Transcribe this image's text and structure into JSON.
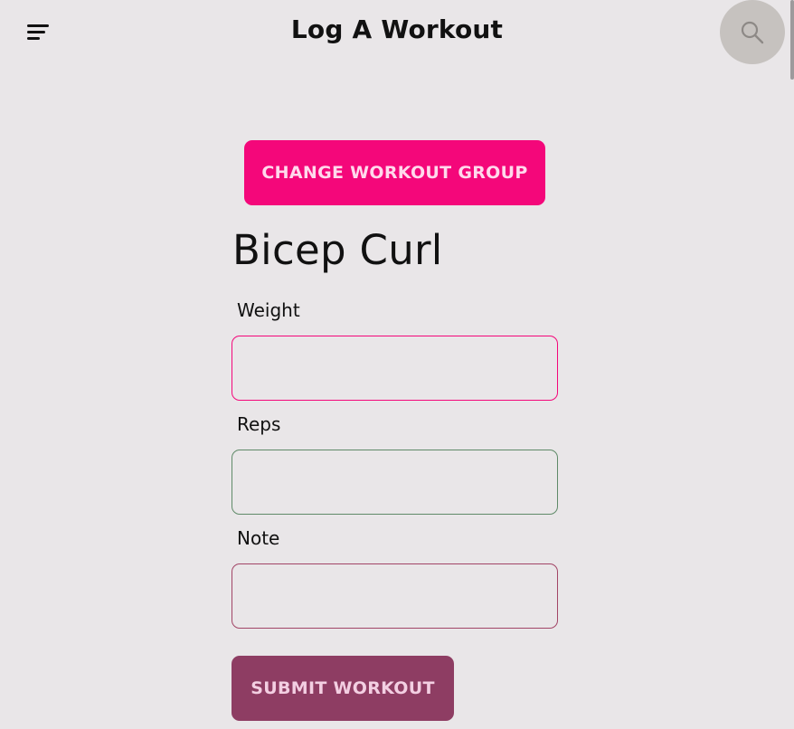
{
  "header": {
    "title": "Log A Workout",
    "menu_icon": "hamburger-menu-icon",
    "search_icon": "search-icon"
  },
  "actions": {
    "change_group_label": "CHANGE WORKOUT GROUP",
    "submit_label": "SUBMIT WORKOUT"
  },
  "exercise": {
    "name": "Bicep Curl"
  },
  "form": {
    "weight": {
      "label": "Weight",
      "value": "",
      "border_color": "#f4077a"
    },
    "reps": {
      "label": "Reps",
      "value": "",
      "border_color": "#5f8a68"
    },
    "note": {
      "label": "Note",
      "value": "",
      "border_color": "#a24566"
    }
  },
  "colors": {
    "background": "#e9e6e8",
    "primary": "#f4077a",
    "submit": "#8e3d63",
    "search_circle": "#c6c2bf"
  }
}
